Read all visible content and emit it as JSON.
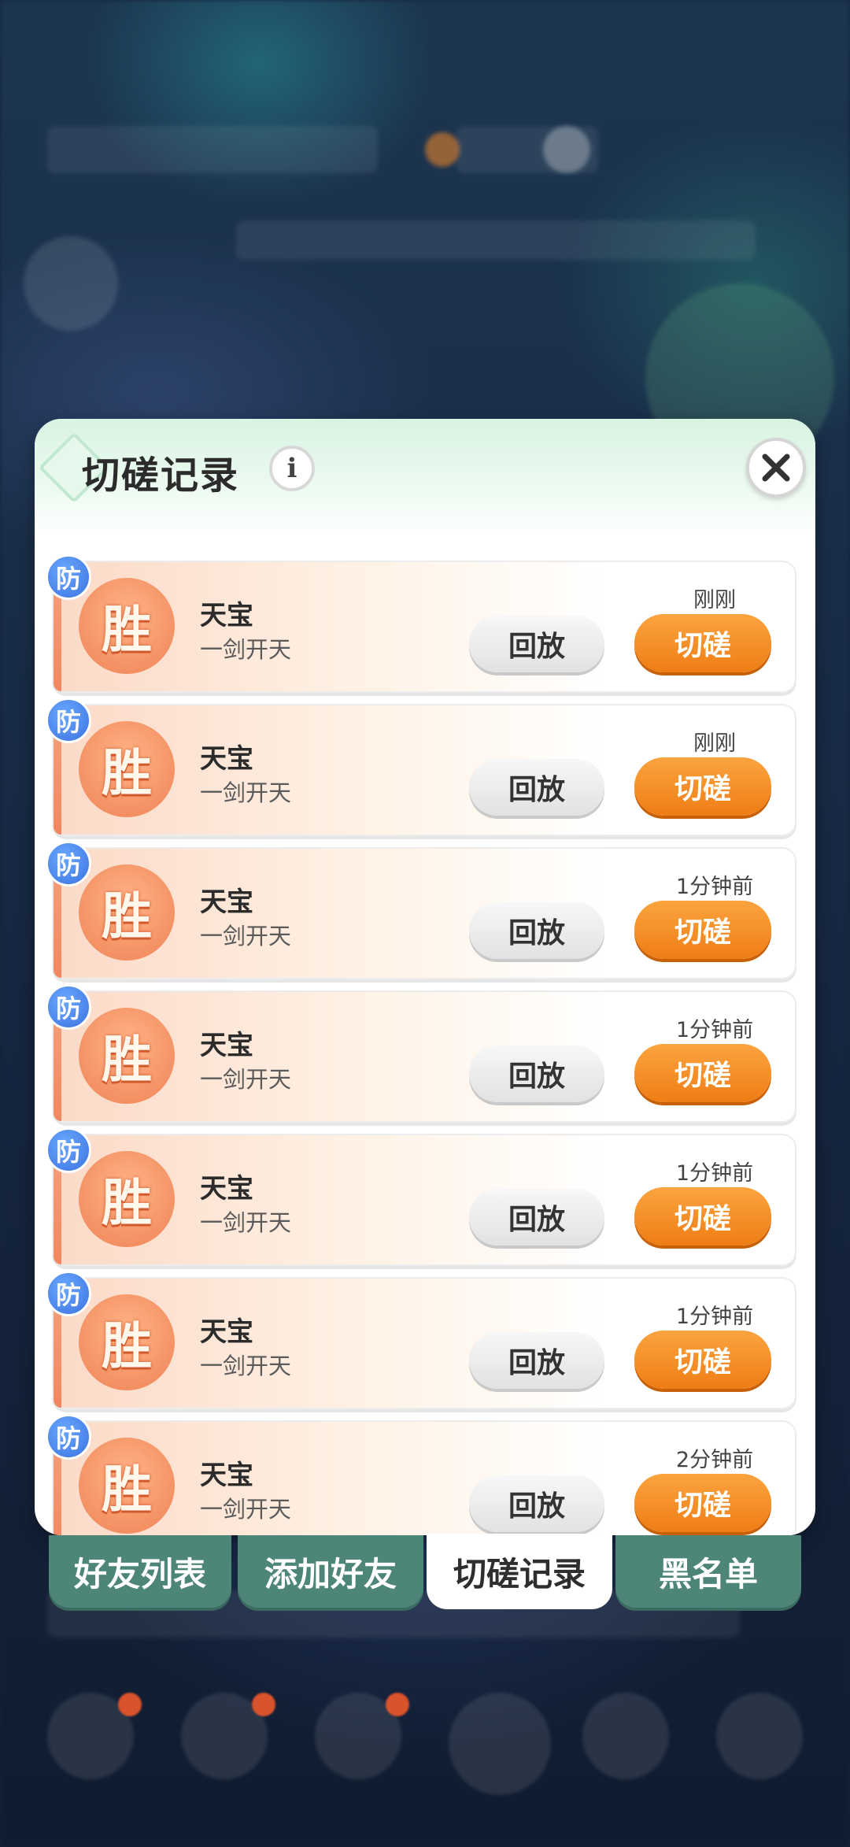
{
  "panel": {
    "title": "切磋记录",
    "info_icon": "info-icon",
    "close_icon": "close-icon"
  },
  "records": [
    {
      "badge": "防",
      "result": "胜",
      "name": "天宝",
      "subtitle": "一剑开天",
      "time": "刚刚",
      "replay_label": "回放",
      "spar_label": "切磋"
    },
    {
      "badge": "防",
      "result": "胜",
      "name": "天宝",
      "subtitle": "一剑开天",
      "time": "刚刚",
      "replay_label": "回放",
      "spar_label": "切磋"
    },
    {
      "badge": "防",
      "result": "胜",
      "name": "天宝",
      "subtitle": "一剑开天",
      "time": "1分钟前",
      "replay_label": "回放",
      "spar_label": "切磋"
    },
    {
      "badge": "防",
      "result": "胜",
      "name": "天宝",
      "subtitle": "一剑开天",
      "time": "1分钟前",
      "replay_label": "回放",
      "spar_label": "切磋"
    },
    {
      "badge": "防",
      "result": "胜",
      "name": "天宝",
      "subtitle": "一剑开天",
      "time": "1分钟前",
      "replay_label": "回放",
      "spar_label": "切磋"
    },
    {
      "badge": "防",
      "result": "胜",
      "name": "天宝",
      "subtitle": "一剑开天",
      "time": "1分钟前",
      "replay_label": "回放",
      "spar_label": "切磋"
    },
    {
      "badge": "防",
      "result": "胜",
      "name": "天宝",
      "subtitle": "一剑开天",
      "time": "2分钟前",
      "replay_label": "回放",
      "spar_label": "切磋"
    }
  ],
  "tabs": [
    {
      "label": "好友列表",
      "active": false
    },
    {
      "label": "添加好友",
      "active": false
    },
    {
      "label": "切磋记录",
      "active": true
    },
    {
      "label": "黑名单",
      "active": false
    }
  ],
  "colors": {
    "accent_orange": "#ef7d15",
    "tab_inactive": "#4e8579",
    "defense_badge": "#3b73e0",
    "win_circle": "#f59668"
  }
}
